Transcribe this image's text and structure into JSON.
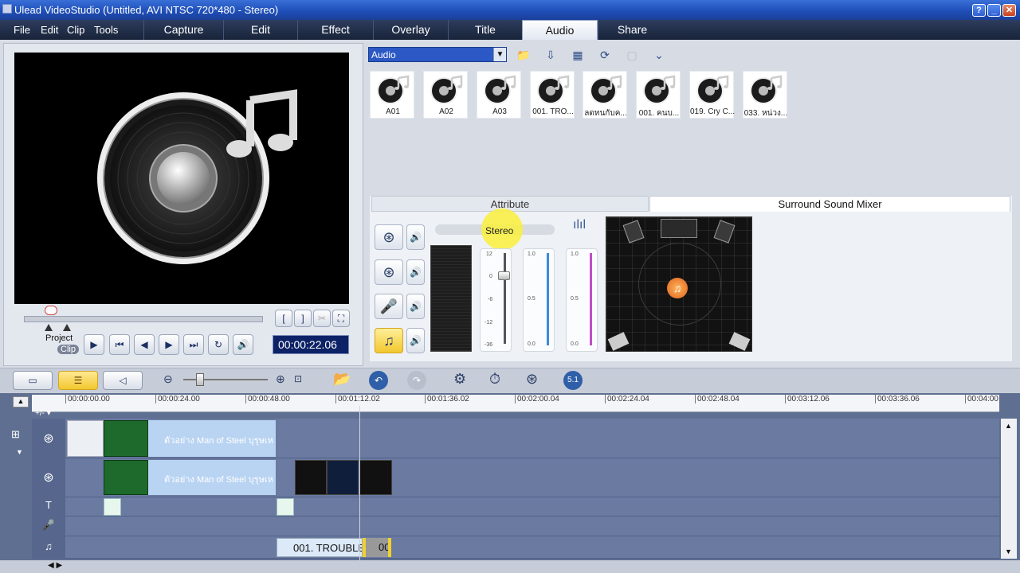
{
  "window": {
    "title": "Ulead VideoStudio (Untitled, AVI NTSC 720*480 - Stereo)"
  },
  "menu": {
    "items": [
      "File",
      "Edit",
      "Clip",
      "Tools"
    ]
  },
  "steps": [
    "Capture",
    "Edit",
    "Effect",
    "Overlay",
    "Title",
    "Audio",
    "Share"
  ],
  "active_step": "Audio",
  "preview": {
    "mode_labels": {
      "project": "Project",
      "clip": "Clip"
    },
    "timecode": "00:00:22.06"
  },
  "library": {
    "selected": "Audio",
    "items": [
      "A01",
      "A02",
      "A03",
      "001. TRO...",
      "ลดทนกับค...",
      "001. คนบ...",
      "019. Cry C...",
      "033. หน่วง..."
    ]
  },
  "mixer": {
    "tabs": [
      "Attribute",
      "Surround Sound Mixer"
    ],
    "active_tab": "Surround Sound Mixer",
    "mode_label": "Stereo",
    "fader_scale": [
      "12",
      "0",
      "-6",
      "-12",
      "-36"
    ],
    "meter_scale": [
      "1.0",
      "0.5",
      "0.0"
    ]
  },
  "timeline": {
    "ruler": [
      "00:00:00.00",
      "00:00:24.00",
      "00:00:48.00",
      "00:01:12.02",
      "00:01:36.02",
      "00:02:00.04",
      "00:02:24.04",
      "00:02:48.04",
      "00:03:12.06",
      "00:03:36.06",
      "00:04:00"
    ],
    "zoom_label": "+/- ▾",
    "video_clip_text": "ตัวอย่าง Man of Steel บุรุษเห",
    "overlay_clip_text": "ตัวอย่าง Man of Steel บุรุษเห",
    "music_clip_text": "001. TROUBLE",
    "music_clip2_text": "00"
  },
  "colors": {
    "accent": "#2b58c4",
    "timeline_bg": "#6a7aa0",
    "clip_blue": "#b9d3f2"
  }
}
